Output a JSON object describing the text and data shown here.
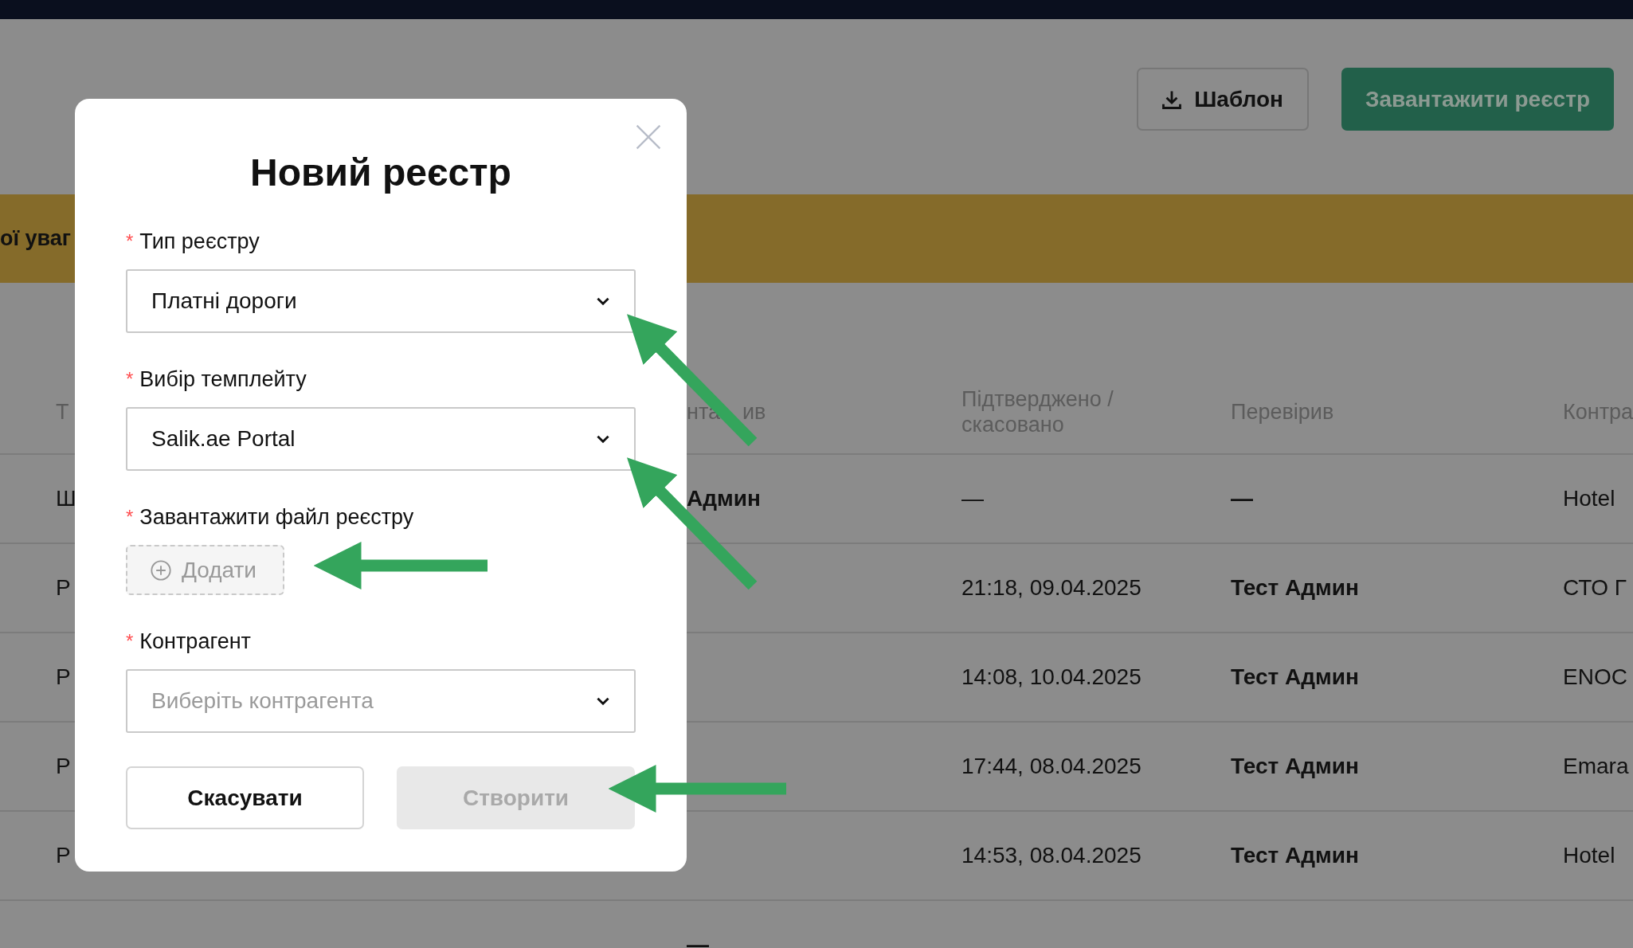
{
  "header": {
    "buttons": [
      {
        "label": "Шаблон",
        "kind": "outline"
      },
      {
        "label": "Завантажити реєстр",
        "kind": "primary"
      }
    ]
  },
  "banner": {
    "text": "ої уваг"
  },
  "table": {
    "columns": {
      "column_1": "Т",
      "column_3": [
        "нта",
        "ив"
      ],
      "column_4": "Підтверджено / скасовано",
      "column_5": "Перевірив",
      "column_6": "Контра"
    },
    "rows": [
      {
        "column_1": "Ш",
        "column_3": "Админ",
        "column_4": "—",
        "column_5": "—",
        "column_6": "Hotel"
      },
      {
        "column_1": "P",
        "column_4": "21:18, 09.04.2025",
        "column_5": "Тест Админ",
        "column_6": "СТО Г"
      },
      {
        "column_1": "P",
        "column_4": "14:08, 10.04.2025",
        "column_5": "Тест Админ",
        "column_6": "ENOC"
      },
      {
        "column_1": "P",
        "column_4": "17:44, 08.04.2025",
        "column_5": "Тест Админ",
        "column_6": "Emara"
      },
      {
        "column_1": "P",
        "column_4": "14:53, 08.04.2025",
        "column_5": "Тест Админ",
        "column_6": "Hotel"
      },
      {
        "column_3": "—"
      }
    ]
  },
  "dialog": {
    "title": "Новий реєстр",
    "fields": [
      {
        "kind": "select",
        "required_mark": "*",
        "label": "Тип реєстру",
        "value": "Платні дороги"
      },
      {
        "kind": "select",
        "required_mark": "*",
        "label": "Вибір темплейту",
        "value": "Salik.ae Portal"
      },
      {
        "kind": "upload",
        "required_mark": "*",
        "label": "Завантажити файл реєстру",
        "button": "Додати"
      },
      {
        "kind": "select",
        "required_mark": "*",
        "label": "Контрагент",
        "placeholder": "Виберіть контрагента"
      }
    ],
    "buttons": [
      {
        "label": "Скасувати",
        "disabled": false
      },
      {
        "label": "Створити",
        "disabled": true
      }
    ]
  }
}
